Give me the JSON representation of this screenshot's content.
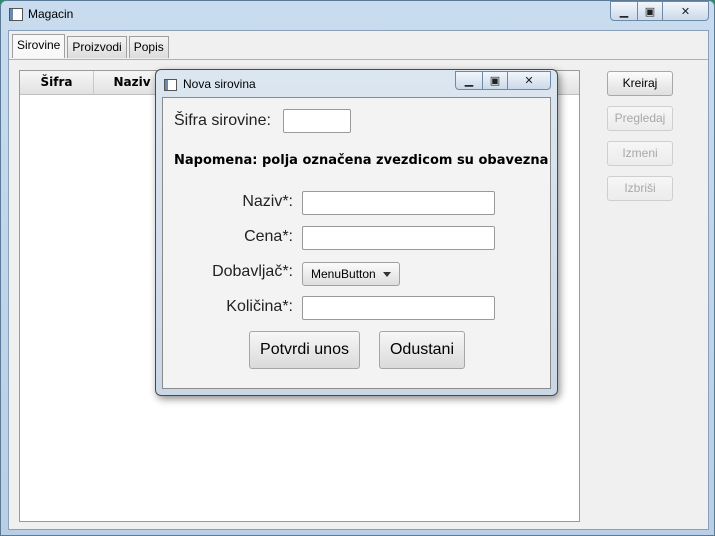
{
  "window": {
    "title": "Magacin"
  },
  "tabs": [
    {
      "label": "Sirovine",
      "active": true
    },
    {
      "label": "Proizvodi",
      "active": false
    },
    {
      "label": "Popis",
      "active": false
    }
  ],
  "table": {
    "columns": [
      "Šifra",
      "Naziv"
    ]
  },
  "side_buttons": [
    {
      "label": "Kreiraj",
      "enabled": true
    },
    {
      "label": "Pregledaj",
      "enabled": false
    },
    {
      "label": "Izmeni",
      "enabled": false
    },
    {
      "label": "Izbriši",
      "enabled": false
    }
  ],
  "dialog": {
    "title": "Nova sirovina",
    "sifra_label": "Šifra sirovine:",
    "sifra_value": "",
    "note": "Napomena: polja označena zvezdicom su obavezna",
    "naziv_label": "Naziv*:",
    "naziv_value": "",
    "cena_label": "Cena*:",
    "cena_value": "",
    "dobavljac_label": "Dobavljač*:",
    "dobavljac_button": "MenuButton",
    "kolicina_label": "Količina*:",
    "kolicina_value": "",
    "confirm_label": "Potvrdi unos",
    "cancel_label": "Odustani"
  },
  "colors": {
    "accent": "#b8cfe6",
    "disabled_text": "#a8a8a8"
  }
}
